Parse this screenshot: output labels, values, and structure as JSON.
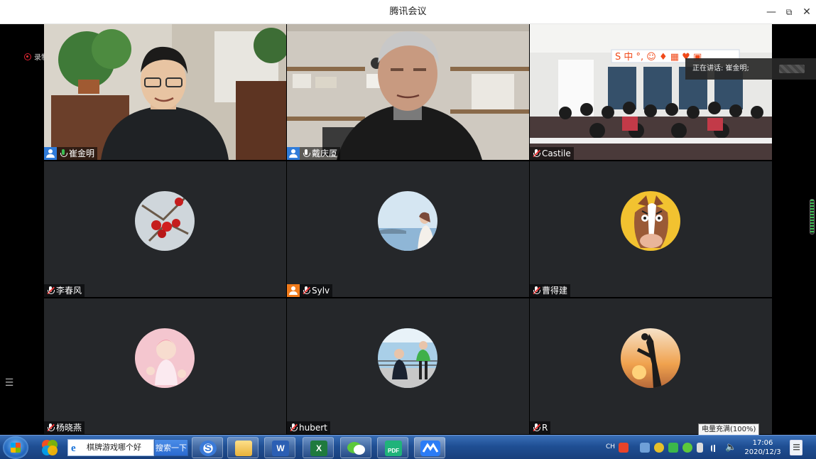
{
  "window": {
    "title": "腾讯会议",
    "minimize_symbol": "—",
    "restore_symbol": "⧉",
    "close_symbol": "✕"
  },
  "recording": {
    "label": "录制中"
  },
  "speaker": {
    "label": "正在讲话: 崔金明;"
  },
  "list_toggle_symbol": "☰",
  "participants": [
    {
      "name": "崔金明",
      "host": true,
      "mic": "green",
      "video": true,
      "active": true
    },
    {
      "name": "戴庆厦",
      "host": true,
      "mic": "white",
      "video": true
    },
    {
      "name": "Castile",
      "host": false,
      "mic": "off",
      "video": true
    },
    {
      "name": "李春风",
      "host": false,
      "mic": "off",
      "video": false
    },
    {
      "name": "Sylv",
      "host": "orange",
      "mic": "off",
      "video": false
    },
    {
      "name": "曹得建",
      "host": false,
      "mic": "off",
      "video": false
    },
    {
      "name": "杨晓燕",
      "host": false,
      "mic": "off",
      "video": false
    },
    {
      "name": "hubert",
      "host": false,
      "mic": "off",
      "video": false
    },
    {
      "name": "R",
      "host": false,
      "mic": "off",
      "video": false
    }
  ],
  "classroom_ime": {
    "glyphs": "S 中 °, ☺ ♦ ▦ ♥ ▣"
  },
  "taskbar": {
    "search_text": "棋牌游戏哪个好",
    "search_button": "搜索一下",
    "excel_letter": "X",
    "word_letter": "W",
    "pdf_label": "PDF",
    "tray_lang": "CH",
    "battery_tooltip": "电量充满(100%)",
    "time": "17:06",
    "date": "2020/12/3"
  },
  "colors": {
    "tile_bg": "#25272a",
    "host_badge_blue": "#2f7bd9",
    "host_badge_orange": "#f07a1a",
    "mic_green": "#3bbd52",
    "mic_muted": "#e33333",
    "taskbar_blue": "#1f4f94"
  }
}
